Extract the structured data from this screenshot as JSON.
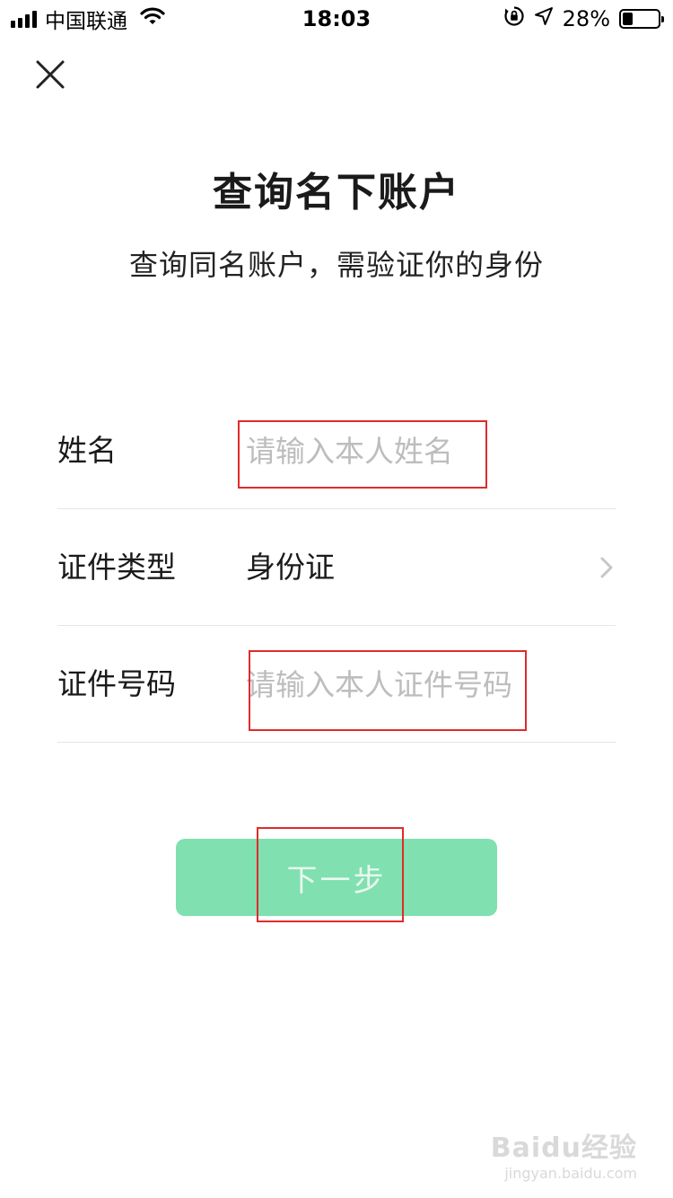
{
  "status_bar": {
    "carrier": "中国联通",
    "time": "18:03",
    "battery": "28%",
    "battery_level": 0.28,
    "icons": [
      "signal-icon",
      "wifi-icon",
      "rotation-lock-icon",
      "location-icon",
      "battery-icon"
    ]
  },
  "header": {
    "close_icon": "close-icon",
    "title": "查询名下账户",
    "subtitle": "查询同名账户，需验证你的身份"
  },
  "form": {
    "name": {
      "label": "姓名",
      "placeholder": "请输入本人姓名",
      "value": ""
    },
    "id_type": {
      "label": "证件类型",
      "value": "身份证",
      "icon": "chevron-right-icon"
    },
    "id_number": {
      "label": "证件号码",
      "placeholder": "请输入本人证件号码",
      "value": ""
    }
  },
  "actions": {
    "next_label": "下一步"
  },
  "watermark": {
    "main": "Baidu经验",
    "sub": "jingyan.baidu.com"
  },
  "colors": {
    "button_bg": "#80e0b0",
    "button_text": "#e8f8ef",
    "placeholder": "#bdbdbd",
    "divider": "#e5e5e5",
    "highlight": "#e02b2b"
  }
}
